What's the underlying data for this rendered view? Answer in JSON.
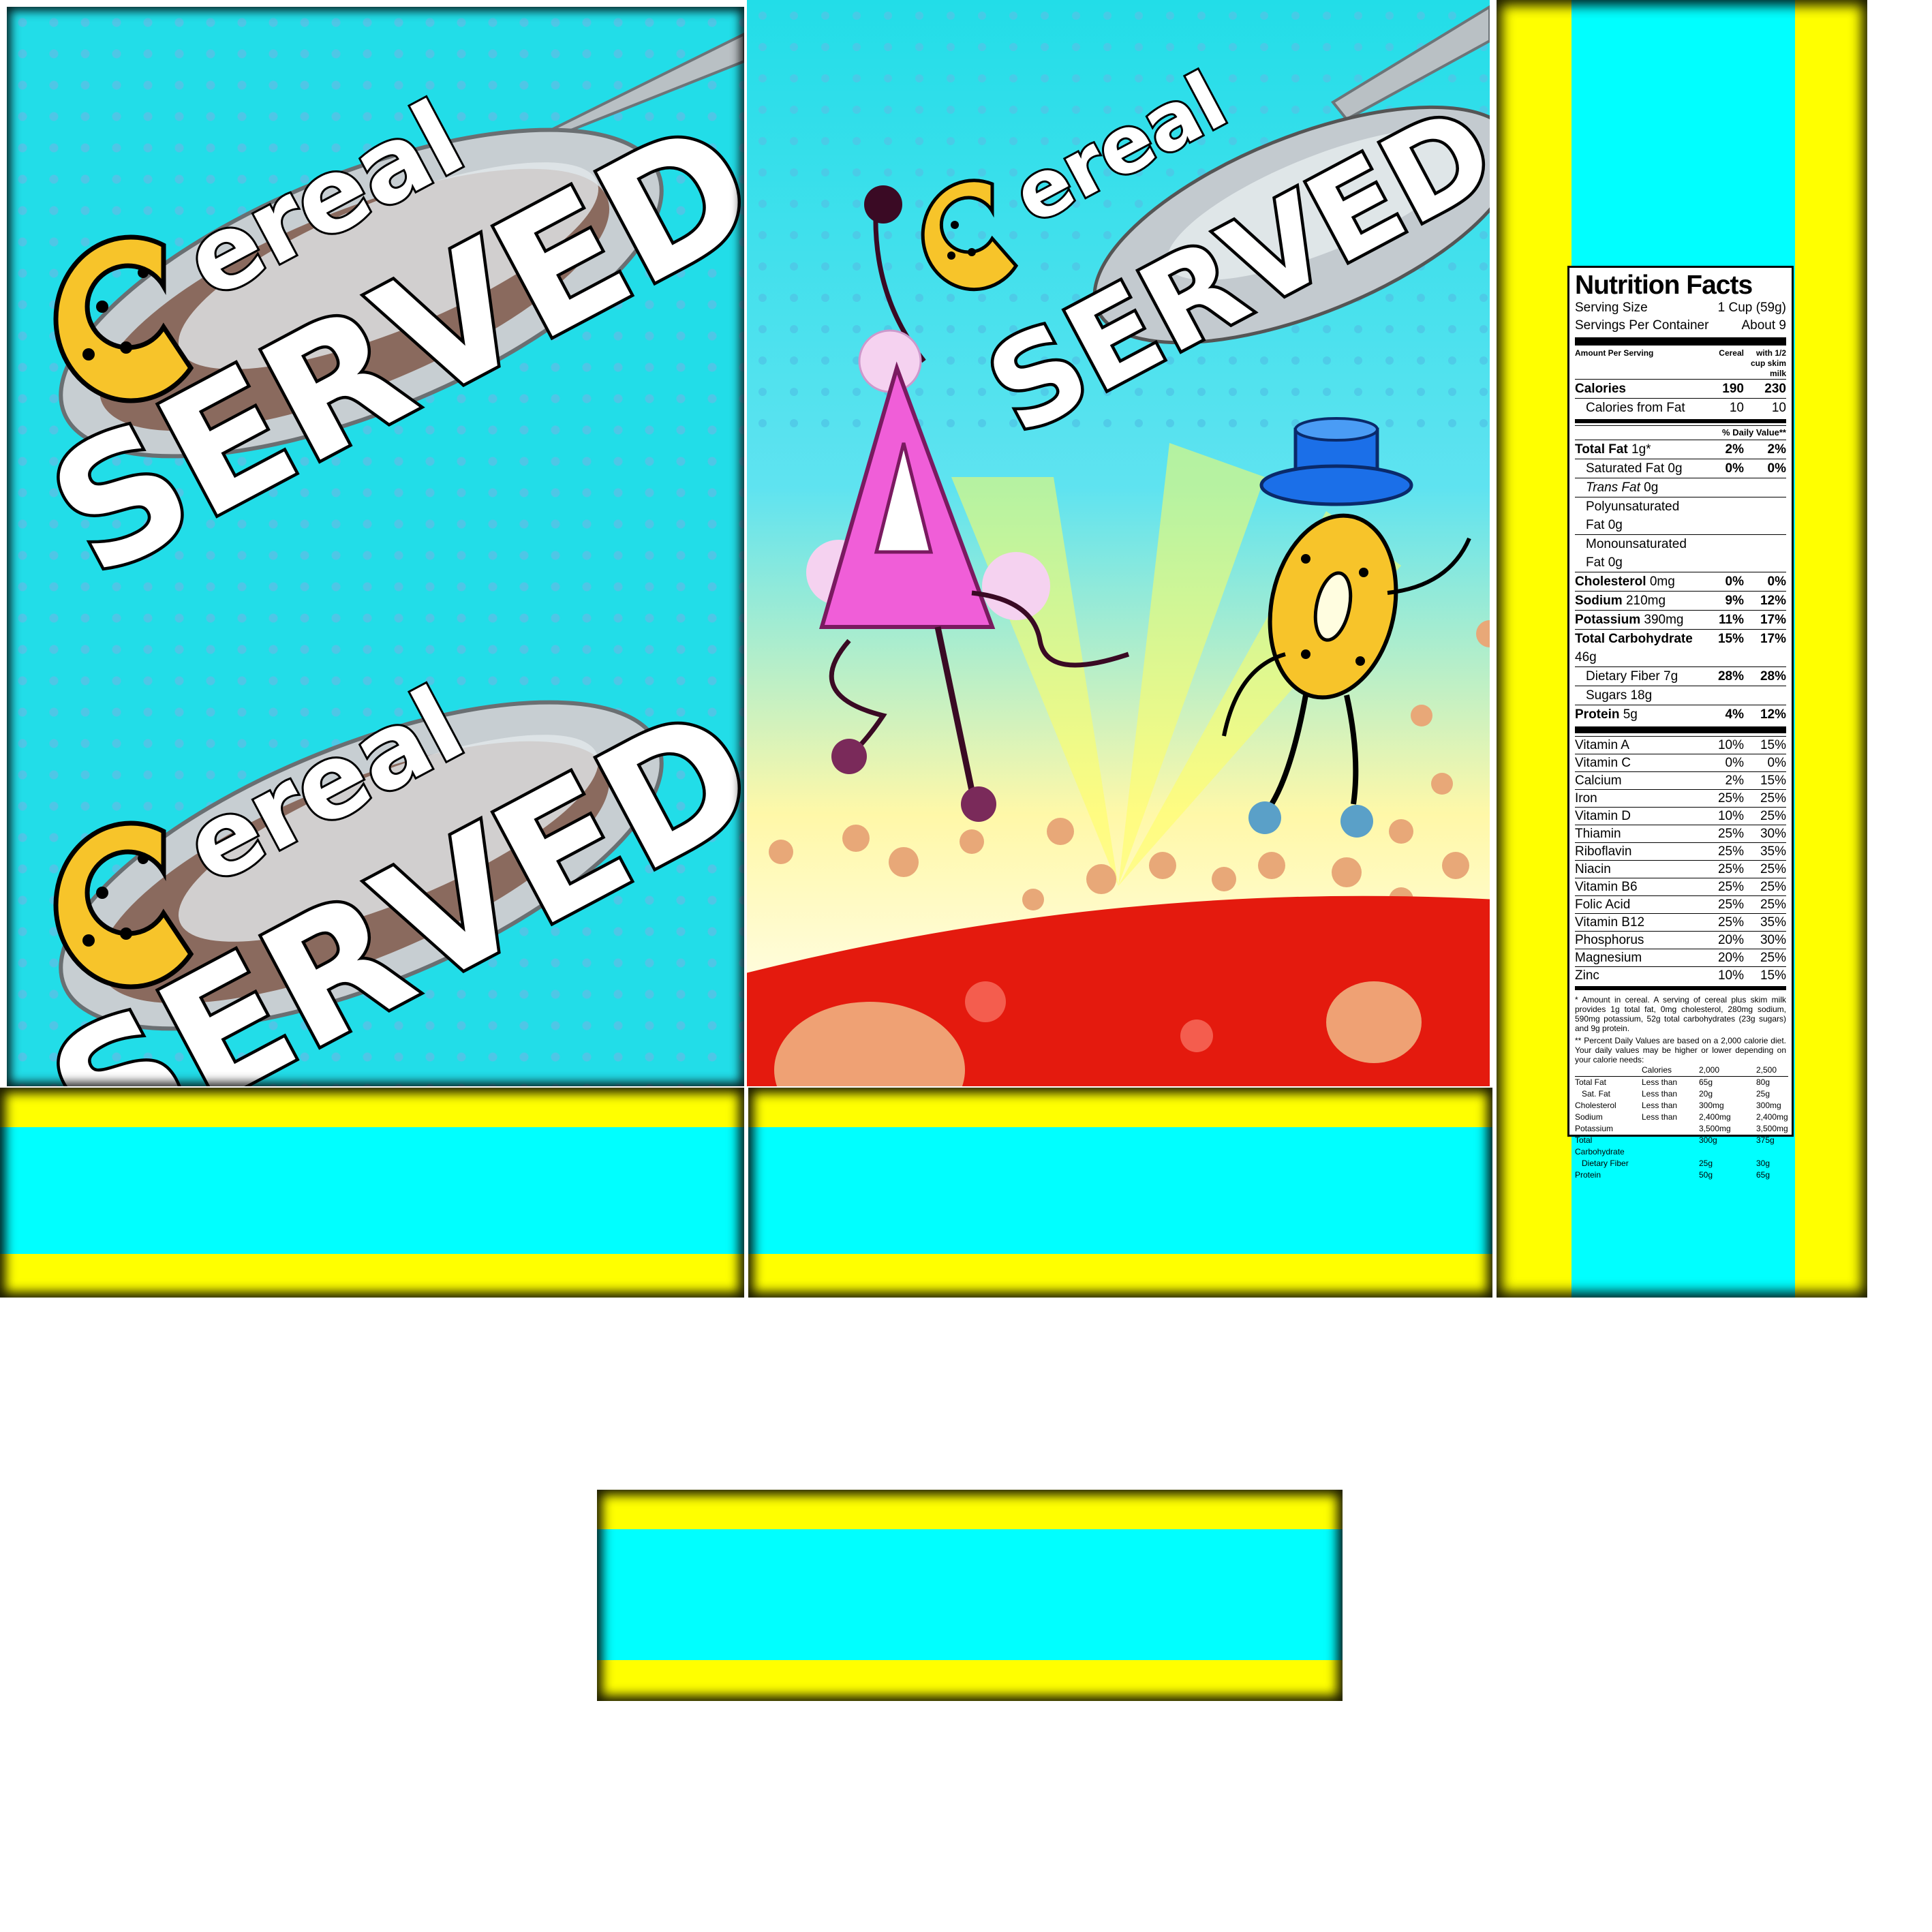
{
  "logo": {
    "word_small": "ereal",
    "word_big": "SERVED"
  },
  "nutrition": {
    "title": "Nutrition Facts",
    "serving_size_label": "Serving Size",
    "serving_size_value": "1 Cup (59g)",
    "servings_label": "Servings Per Container",
    "servings_value": "About 9",
    "amount_per_serving": "Amount Per Serving",
    "col_cereal": "Cereal",
    "col_milk": "with 1/2 cup skim milk",
    "calories": {
      "label": "Calories",
      "cereal": "190",
      "milk": "230"
    },
    "calories_fat": {
      "label": "Calories from Fat",
      "cereal": "10",
      "milk": "10"
    },
    "daily_value_header": "% Daily Value**",
    "nutrients": [
      {
        "label": "Total Fat",
        "amount": "1g*",
        "cereal": "2%",
        "milk": "2%",
        "bold": true,
        "indent": false
      },
      {
        "label": "Saturated Fat",
        "amount": "0g",
        "cereal": "0%",
        "milk": "0%",
        "bold": false,
        "indent": true
      },
      {
        "label": "Trans Fat",
        "amount": "0g",
        "cereal": "",
        "milk": "",
        "bold": false,
        "indent": true
      },
      {
        "label": "Polyunsaturated Fat",
        "amount": "0g",
        "cereal": "",
        "milk": "",
        "bold": false,
        "indent": true
      },
      {
        "label": "Monounsaturated Fat",
        "amount": "0g",
        "cereal": "",
        "milk": "",
        "bold": false,
        "indent": true
      },
      {
        "label": "Cholesterol",
        "amount": "0mg",
        "cereal": "0%",
        "milk": "0%",
        "bold": true,
        "indent": false
      },
      {
        "label": "Sodium",
        "amount": "210mg",
        "cereal": "9%",
        "milk": "12%",
        "bold": true,
        "indent": false
      },
      {
        "label": "Potassium",
        "amount": "390mg",
        "cereal": "11%",
        "milk": "17%",
        "bold": true,
        "indent": false
      },
      {
        "label": "Total Carbohydrate",
        "amount": "46g",
        "cereal": "15%",
        "milk": "17%",
        "bold": true,
        "indent": false
      },
      {
        "label": "Dietary Fiber",
        "amount": "7g",
        "cereal": "28%",
        "milk": "28%",
        "bold": false,
        "indent": true
      },
      {
        "label": "Sugars",
        "amount": "18g",
        "cereal": "",
        "milk": "",
        "bold": false,
        "indent": true
      },
      {
        "label": "Protein",
        "amount": "5g",
        "cereal": "4%",
        "milk": "12%",
        "bold": true,
        "indent": false
      }
    ],
    "vitamins": [
      {
        "label": "Vitamin A",
        "cereal": "10%",
        "milk": "15%"
      },
      {
        "label": "Vitamin C",
        "cereal": "0%",
        "milk": "0%"
      },
      {
        "label": "Calcium",
        "cereal": "2%",
        "milk": "15%"
      },
      {
        "label": "Iron",
        "cereal": "25%",
        "milk": "25%"
      },
      {
        "label": "Vitamin D",
        "cereal": "10%",
        "milk": "25%"
      },
      {
        "label": "Thiamin",
        "cereal": "25%",
        "milk": "30%"
      },
      {
        "label": "Riboflavin",
        "cereal": "25%",
        "milk": "35%"
      },
      {
        "label": "Niacin",
        "cereal": "25%",
        "milk": "25%"
      },
      {
        "label": "Vitamin B6",
        "cereal": "25%",
        "milk": "25%"
      },
      {
        "label": "Folic Acid",
        "cereal": "25%",
        "milk": "25%"
      },
      {
        "label": "Vitamin B12",
        "cereal": "25%",
        "milk": "35%"
      },
      {
        "label": "Phosphorus",
        "cereal": "20%",
        "milk": "30%"
      },
      {
        "label": "Magnesium",
        "cereal": "20%",
        "milk": "25%"
      },
      {
        "label": "Zinc",
        "cereal": "10%",
        "milk": "15%"
      }
    ],
    "footnote_1": "* Amount in cereal. A serving of cereal plus skim milk provides 1g total fat, 0mg cholesterol, 280mg sodium, 590mg potassium, 52g total carbohydrates (23g sugars) and 9g protein.",
    "footnote_2": "** Percent Daily Values are based on a 2,000 calorie diet. Your daily values may be higher or lower depending on your calorie needs:",
    "dv_table": {
      "header": [
        "",
        "Calories",
        "2,000",
        "2,500"
      ],
      "rows": [
        [
          "Total Fat",
          "Less than",
          "65g",
          "80g"
        ],
        [
          "Sat. Fat",
          "Less than",
          "20g",
          "25g"
        ],
        [
          "Cholesterol",
          "Less than",
          "300mg",
          "300mg"
        ],
        [
          "Sodium",
          "Less than",
          "2,400mg",
          "2,400mg"
        ],
        [
          "Potassium",
          "",
          "3,500mg",
          "3,500mg"
        ],
        [
          "Total Carbohydrate",
          "",
          "300g",
          "375g"
        ],
        [
          "Dietary Fiber",
          "",
          "25g",
          "30g"
        ],
        [
          "Protein",
          "",
          "50g",
          "65g"
        ]
      ]
    }
  },
  "colors": {
    "background_cyan": "#22dde8",
    "flap_yellow": "#ffff00",
    "flap_cyan": "#00ffff",
    "bowl_red": "#e41a0e",
    "pink_character": "#f05ed8",
    "blue_hat": "#1b6fe8"
  }
}
